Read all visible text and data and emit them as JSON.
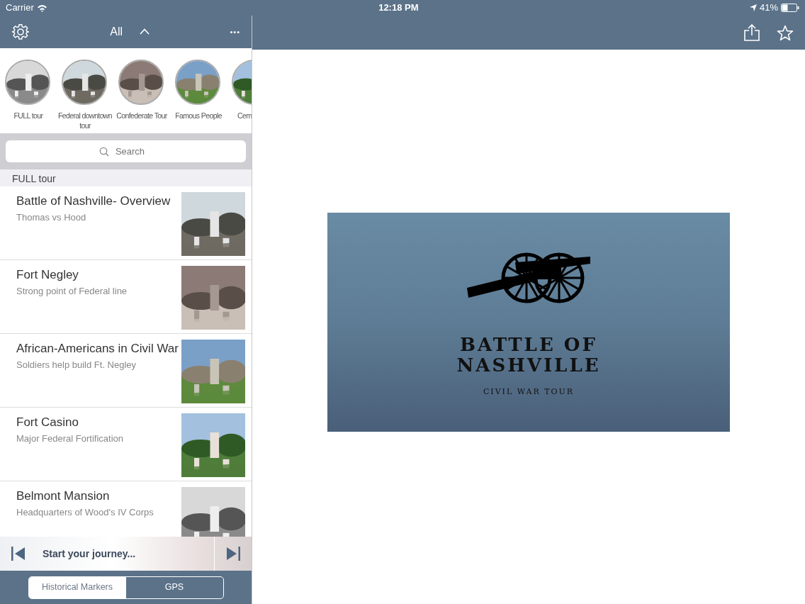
{
  "status_bar": {
    "carrier": "Carrier",
    "time": "12:18 PM",
    "battery": "41%"
  },
  "nav": {
    "filter": "All",
    "more": "•••"
  },
  "tours": [
    {
      "name": "FULL tour",
      "selected": false
    },
    {
      "name": "Federal downtown tour",
      "selected": false
    },
    {
      "name": "Confederate Tour",
      "selected": false
    },
    {
      "name": "Famous People",
      "selected": false
    },
    {
      "name": "Cem",
      "selected": false
    }
  ],
  "search": {
    "placeholder": "Search"
  },
  "section": "FULL tour",
  "stops": [
    {
      "title": "Battle of Nashville- Overview",
      "subtitle": "Thomas vs Hood"
    },
    {
      "title": "Fort Negley",
      "subtitle": "Strong point of Federal line"
    },
    {
      "title": "African-Americans in Civil War",
      "subtitle": "Soldiers help build Ft. Negley"
    },
    {
      "title": "Fort Casino",
      "subtitle": "Major Federal Fortification"
    },
    {
      "title": "Belmont Mansion",
      "subtitle": "Headquarters of Wood's IV Corps"
    }
  ],
  "player": {
    "label": "Start your journey..."
  },
  "segments": [
    {
      "label": "Historical Markers",
      "selected": true
    },
    {
      "label": "GPS",
      "selected": false
    }
  ],
  "slide": {
    "title_line_1": "BATTLE OF",
    "title_line_2": "NASHVILLE",
    "subtitle": "CIVIL WAR TOUR"
  }
}
